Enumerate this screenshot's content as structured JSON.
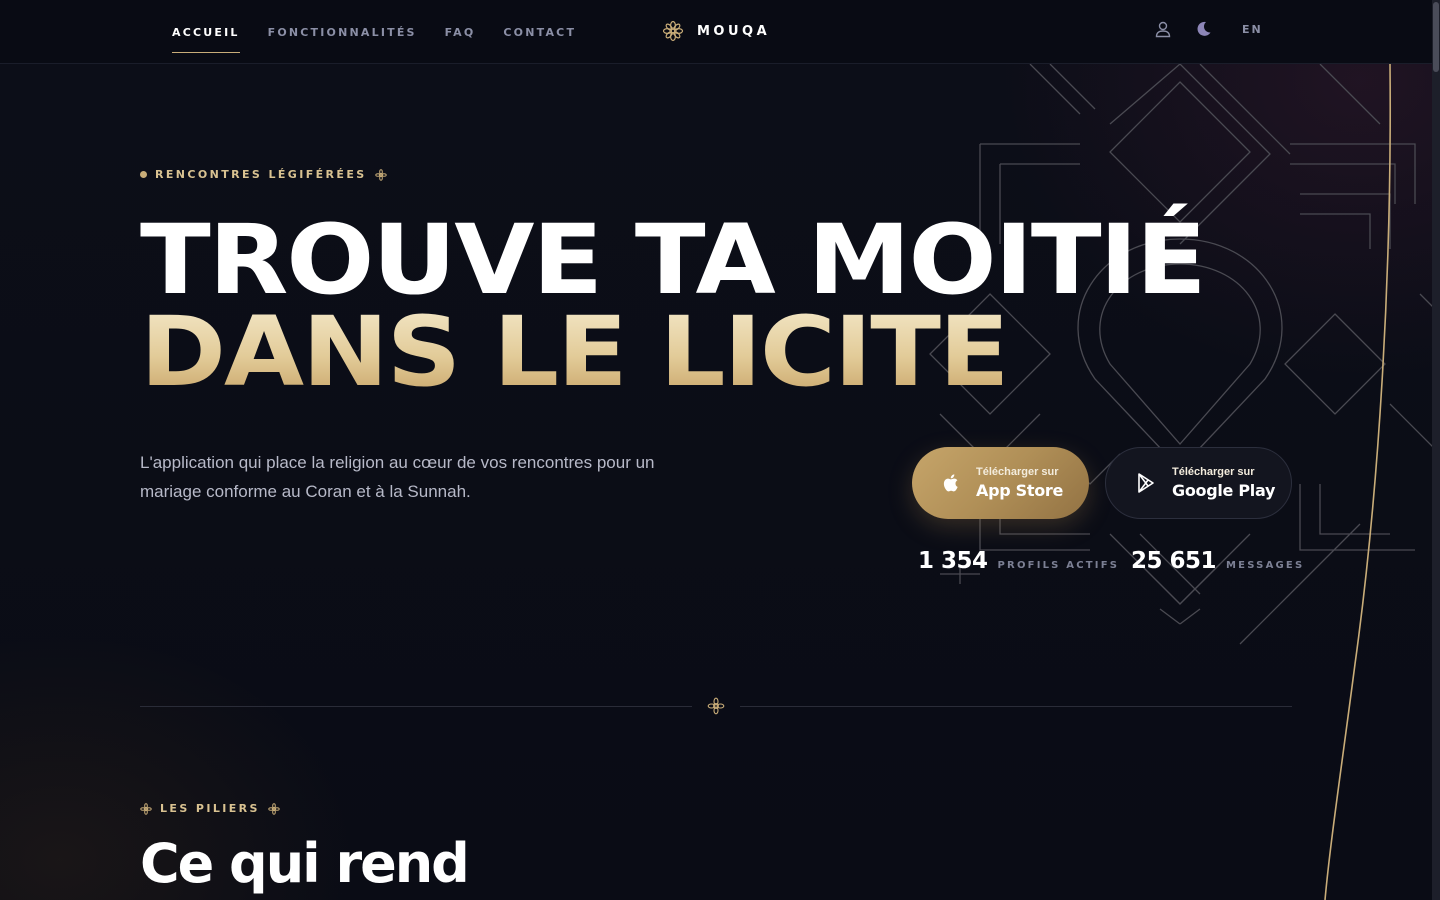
{
  "nav": {
    "links": [
      {
        "label": "ACCUEIL",
        "active": true
      },
      {
        "label": "FONCTIONNALITÉS",
        "active": false
      },
      {
        "label": "FAQ",
        "active": false
      },
      {
        "label": "CONTACT",
        "active": false
      }
    ],
    "brand": "MOUQA",
    "brand_icon": "rosette-icon",
    "profile_icon": "user-icon",
    "theme_icon": "moon-icon",
    "language": "EN"
  },
  "hero": {
    "eyebrow": "RENCONTRES LÉGIFÉRÉES",
    "headline_line1": "TROUVE TA MOITIÉ",
    "headline_line2": "DANS LE LICITE",
    "lead": "L'application qui place la religion au cœur de vos rencontres pour un mariage conforme au Coran et à la Sunnah.",
    "app_store": {
      "small": "Télécharger sur",
      "big": "App Store",
      "icon": "apple-icon"
    },
    "google_play": {
      "small": "Télécharger sur",
      "big": "Google Play",
      "icon": "play-icon"
    },
    "stats": [
      {
        "value": "1 354",
        "label": "PROFILS ACTIFS"
      },
      {
        "value": "25 651",
        "label": "MESSAGES"
      }
    ]
  },
  "pillars": {
    "eyebrow": "LES PILIERS",
    "title": "Ce qui rend"
  },
  "colors": {
    "background": "#0b0d17",
    "gold": "#c9ad79",
    "gold_light": "#e2cb98",
    "muted": "#8b8fa6"
  }
}
